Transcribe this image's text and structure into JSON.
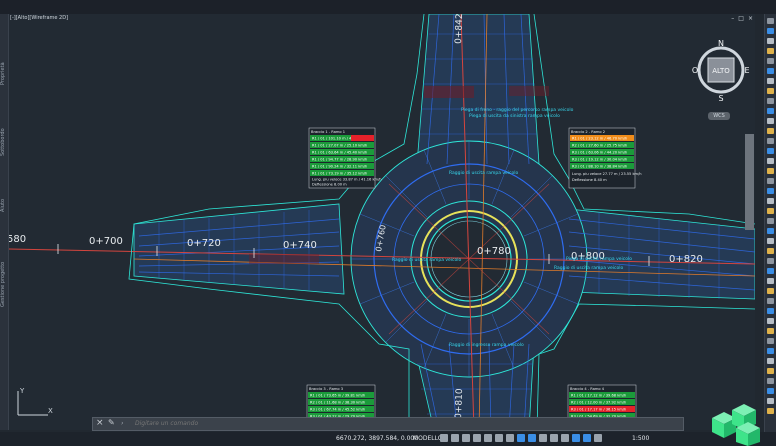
{
  "viewport": {
    "label": "[-][Alto][Wireframe 2D]",
    "controls": [
      "–",
      "□",
      "×"
    ]
  },
  "left_panel": [
    "Proprietà",
    "Sottobordo",
    "Aiuto",
    "Gestione progetto"
  ],
  "viewcube": {
    "face": "ALTO",
    "north": "N",
    "south": "S",
    "east": "E",
    "west": "O",
    "wcs": "WCS"
  },
  "stations": {
    "s580": "580",
    "s700": "0+700",
    "s720": "0+720",
    "s740": "0+740",
    "s760": "0+760",
    "s780": "0+780",
    "s800": "0+800",
    "s820": "0+820",
    "s842": "0+842",
    "s810": "0+810"
  },
  "tables": [
    {
      "title": "Braccio 1 - Ramo 1",
      "rows": [
        "R1 / 01 / 101.10 m / 48.50 km/h",
        "R1 / 01 / 27.07 m / 25.10 km/h",
        "R1 / 01 / 63.64 m / 45.40 km/h",
        "R1 / 01 / 94.77 m / 28.90 km/h",
        "R1 / 01 / 90.24 m / 32.11 km/h",
        "R1 / 01 / 73.19 m / 35.12 km/h"
      ],
      "footer": [
        "Lung. piu veloce   33.87 m / 41.16 km/h",
        "Deflessione   8.00 m"
      ]
    },
    {
      "title": "Braccio 2 - Ramo 2",
      "rows": [
        "R1 / 01 / 23.12 m / 46.70 km/h",
        "R2 / 01 / 27.60 m / 25.75 km/h",
        "R3 / 01 / 63.06 m / 44.20 km/h",
        "R3 / 01 / 19.12 m / 30.04 km/h",
        "R3 / 01 / 88.10 m / 38.84 km/h"
      ],
      "footer": [
        "Lung. piu veloce   27.77 m / 23.55 km/h",
        "Deflessione   8.40 m"
      ]
    },
    {
      "title": "Braccio 3 - Ramo 3",
      "rows": [
        "R1 / 01 / 73.65 m / 39.81 km/h",
        "R2 / 01 / 11.68 m / 38.30 km/h",
        "R3 / 01 / 67.74 m / 45.52 km/h",
        "R3 / 01 / 43.22 m / 29.70 km/h"
      ],
      "footer": []
    },
    {
      "title": "Braccio 4 - Ramo 4",
      "rows": [
        "R1 / 01 / 17.12 m / 39.68 km/h",
        "R2 / 01 / 12.00 m / 37.92 km/h",
        "R3 / 01 / 17.17 m / 36.15 km/h",
        "R3 / 01 / 54.69 m / 32.70 km/h"
      ],
      "footer": []
    }
  ],
  "annotations": {
    "a1": "Piega di freno - raggio del percorso rampa veicolo",
    "a2": "Piega di uscita da sinistra rampa veicolo",
    "a3": "Raggio di uscita rampa veicolo",
    "a4": "Raggio di uscita rampa veicolo",
    "a5": "Piega di uscita rampa veicolo",
    "a6": "Raggio di ingresso rampa veicolo",
    "a7": "Raggio di uscita rampa veicolo"
  },
  "command": {
    "prompt": "›",
    "placeholder": "Digitare un comando"
  },
  "status": {
    "coords": "6670.272, 3897.584, 0.000",
    "space": "MODELLO",
    "scale": "1:500"
  },
  "colors": {
    "background": "#222a33",
    "road_blue": "#2f6cf0",
    "outline_cyan": "#2ee6d8",
    "text_cyan": "#37d9ee",
    "axis_red": "#d3453e",
    "ring_yellow": "#e7e25a",
    "table_green": "#1b9b3a",
    "table_red": "#e5212a",
    "table_orange": "#f08c1a",
    "logo_green": "#3ee48a"
  }
}
